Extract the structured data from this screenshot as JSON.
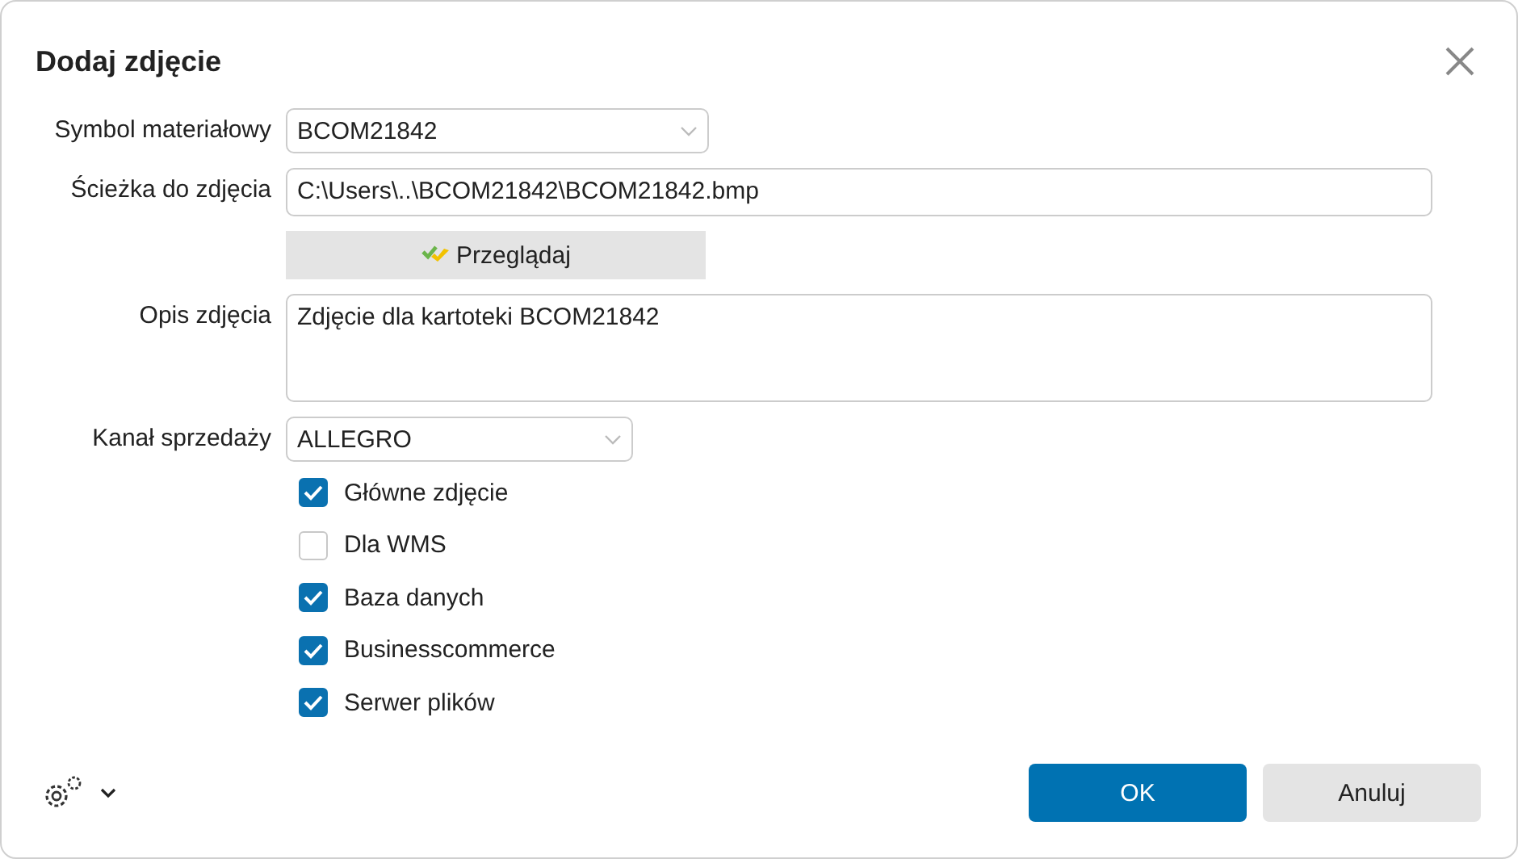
{
  "dialog": {
    "title": "Dodaj zdjęcie"
  },
  "fields": [
    {
      "kind": "select",
      "label": "Symbol materiałowy",
      "value": "BCOM21842"
    },
    {
      "kind": "text",
      "label": "Ścieżka do zdjęcia",
      "value": "C:\\Users\\..\\BCOM21842\\BCOM21842.bmp"
    },
    {
      "kind": "button",
      "label": "Przeglądaj"
    },
    {
      "kind": "textarea",
      "label": "Opis zdjęcia",
      "value": "Zdjęcie dla kartoteki BCOM21842"
    },
    {
      "kind": "select",
      "label": "Kanał sprzedaży",
      "value": "ALLEGRO"
    }
  ],
  "checkboxes": [
    {
      "label": "Główne zdjęcie",
      "checked": true
    },
    {
      "label": "Dla WMS",
      "checked": false
    },
    {
      "label": "Baza danych",
      "checked": true
    },
    {
      "label": "Businesscommerce",
      "checked": true
    },
    {
      "label": "Serwer plików",
      "checked": true
    }
  ],
  "buttons": [
    {
      "label": "OK",
      "kind": "primary"
    },
    {
      "label": "Anuluj",
      "kind": "secondary"
    }
  ]
}
